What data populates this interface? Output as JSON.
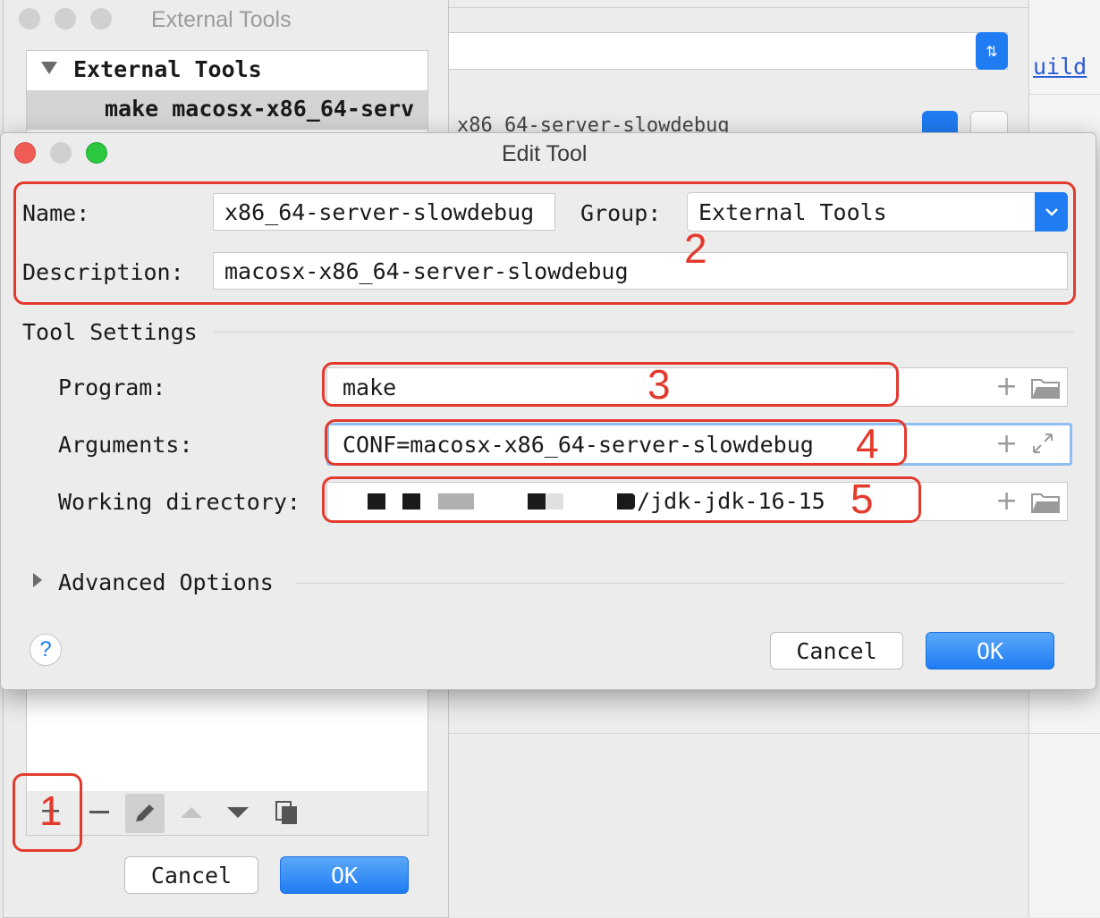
{
  "background_window": {
    "build_link": "uild",
    "config_text": "x86_64-server-slowdebug"
  },
  "external_tools_dialog": {
    "title": "External Tools",
    "tree": {
      "group_label": "External Tools",
      "item_label": "make macosx-x86_64-serv"
    },
    "toolbar_icons": [
      "plus-icon",
      "minus-icon",
      "pencil-icon",
      "arrow-up-icon",
      "arrow-down-icon",
      "copy-icon"
    ],
    "cancel_label": "Cancel",
    "ok_label": "OK"
  },
  "edit_tool": {
    "title": "Edit Tool",
    "name_label": "Name:",
    "name_value": "x86_64-server-slowdebug",
    "group_label": "Group:",
    "group_value": "External Tools",
    "description_label": "Description:",
    "description_value": "macosx-x86_64-server-slowdebug",
    "tool_settings_label": "Tool Settings",
    "program_label": "Program:",
    "program_value": "make",
    "arguments_label": "Arguments:",
    "arguments_value": "CONF=macosx-x86_64-server-slowdebug",
    "working_dir_label": "Working directory:",
    "working_dir_value": "/jdk-jdk-16-15",
    "advanced_options_label": "Advanced Options",
    "help_label": "?",
    "cancel_label": "Cancel",
    "ok_label": "OK"
  },
  "annotations": [
    "1",
    "2",
    "3",
    "4",
    "5"
  ],
  "colors": {
    "annotation_red": "#e23b2e",
    "primary_blue": "#1f7cf2",
    "traffic_red": "#ee5c55",
    "traffic_green": "#2bc840",
    "traffic_inactive": "#d0d0d0"
  }
}
